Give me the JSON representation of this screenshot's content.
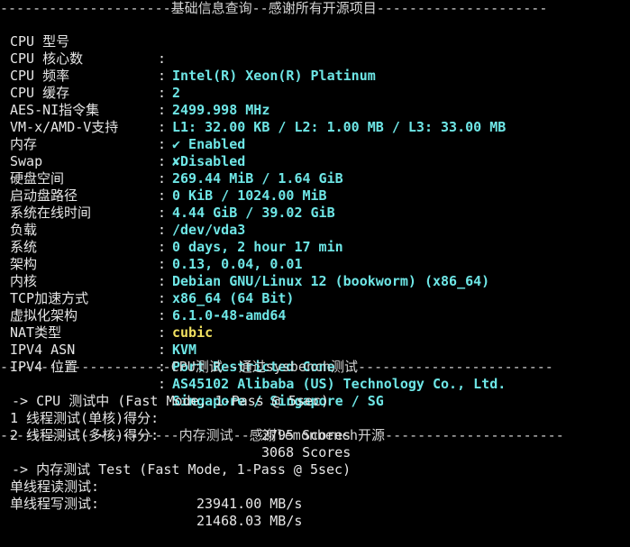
{
  "headers": {
    "basic": "---------------------基础信息查询--感谢所有开源项目---------------------",
    "cpu": "---------------------CPU测试--通过sysbench测试------------------------",
    "mem": "----------------------内存测试--感谢lemonbench开源----------------------"
  },
  "basic_info": [
    {
      "label": "CPU 型号",
      "value": "Intel(R) Xeon(R) Platinum"
    },
    {
      "label": "CPU 核心数",
      "value": "2"
    },
    {
      "label": "CPU 频率",
      "value": "2499.998 MHz"
    },
    {
      "label": "CPU 缓存",
      "value": "L1: 32.00 KB / L2: 1.00 MB / L3: 33.00 MB"
    },
    {
      "label": "AES-NI指令集",
      "value": "✔ Enabled"
    },
    {
      "label": "VM-x/AMD-V支持",
      "value": "✘Disabled"
    },
    {
      "label": "内存",
      "value": "269.44 MiB / 1.64 GiB"
    },
    {
      "label": "Swap",
      "value": "0 KiB / 1024.00 MiB"
    },
    {
      "label": "硬盘空间",
      "value": "4.44 GiB / 39.02 GiB"
    },
    {
      "label": "启动盘路径",
      "value": "/dev/vda3"
    },
    {
      "label": "系统在线时间",
      "value": "0 days, 2 hour 17 min"
    },
    {
      "label": "负载",
      "value": "0.13, 0.04, 0.01"
    },
    {
      "label": "系统",
      "value": "Debian GNU/Linux 12 (bookworm) (x86_64)"
    },
    {
      "label": "架构",
      "value": "x86_64 (64 Bit)"
    },
    {
      "label": "内核",
      "value": "6.1.0-48-amd64"
    },
    {
      "label": "TCP加速方式",
      "value": "cubic"
    },
    {
      "label": "虚拟化架构",
      "value": "KVM"
    },
    {
      "label": "NAT类型",
      "value": "Port Restricted Cone"
    },
    {
      "label": "IPV4 ASN",
      "value": "AS45102 Alibaba (US) Technology Co., Ltd."
    },
    {
      "label": "IPV4 位置",
      "value": "Singapore / Singapore / SG"
    }
  ],
  "colon": ":",
  "cpu_test": {
    "mode": " -> CPU 测试中 (Fast Mode, 1-Pass @ 5sec)",
    "single_label": "1 线程测试(单核)得分:",
    "single_score": "2795 Scores",
    "multi_label": "2 线程测试(多核)得分:",
    "multi_score": "3068 Scores"
  },
  "mem_test": {
    "mode": " -> 内存测试 Test (Fast Mode, 1-Pass @ 5sec)",
    "read_label": "单线程读测试:",
    "read_value": "23941.00 MB/s",
    "write_label": "单线程写测试:",
    "write_value": "21468.03 MB/s"
  },
  "colors": {
    "background": "#000000",
    "text": "#e6e6e6",
    "value_cyan": "#6ee6e6",
    "value_yellow": "#f0e060"
  }
}
